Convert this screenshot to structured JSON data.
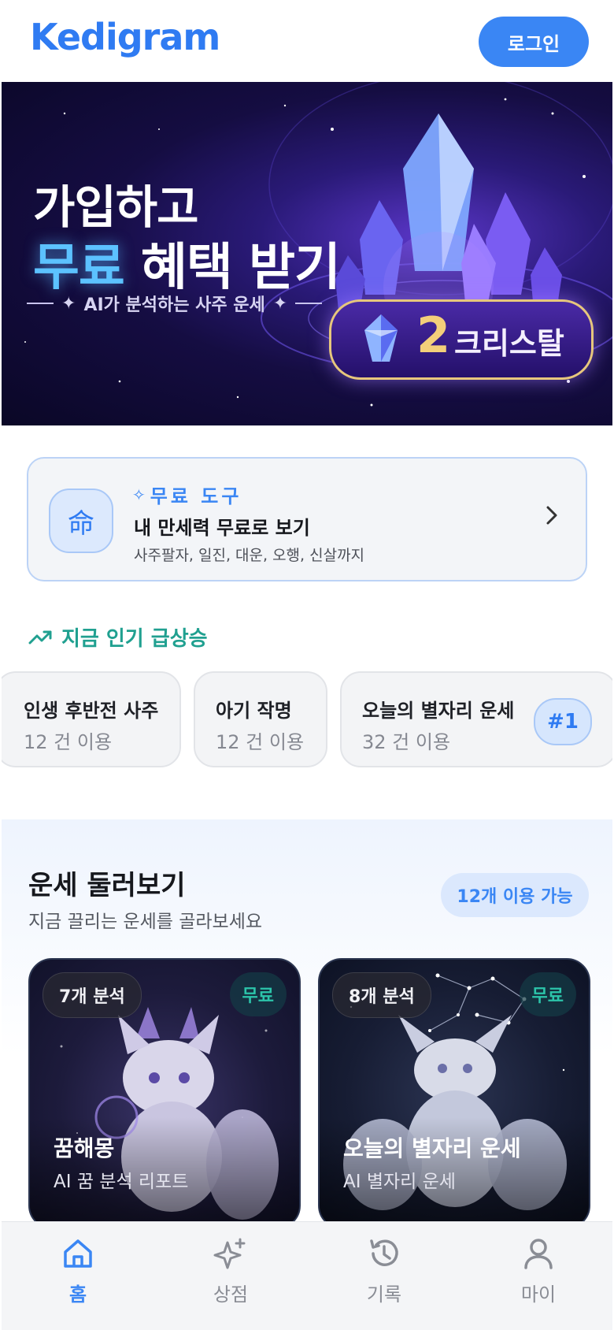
{
  "header": {
    "logo": "Kedigram",
    "login_label": "로그인"
  },
  "banner": {
    "title_line1": "가입하고",
    "title_highlight": "무료",
    "title_rest": "혜택 받기",
    "subtitle": "AI가 분석하는 사주 운세",
    "crystal_count": "2",
    "crystal_label": "크리스탈"
  },
  "free_tool": {
    "tag": "무료 도구",
    "icon_glyph": "命",
    "title": "내 만세력 무료로 보기",
    "description": "사주팔자, 일진, 대운, 오행, 신살까지"
  },
  "trending": {
    "title": "지금 인기 급상승",
    "items": [
      {
        "title": "인생 후반전 사주",
        "count": "12 건 이용"
      },
      {
        "title": "아기 작명",
        "count": "12 건 이용"
      },
      {
        "title": "오늘의 별자리 운세",
        "count": "32 건 이용",
        "rank": "#1"
      }
    ]
  },
  "browse": {
    "title": "운세 둘러보기",
    "subtitle": "지금 끌리는 운세를 골라보세요",
    "available": "12개 이용 가능",
    "cards": [
      {
        "count": "7개 분석",
        "badge": "무료",
        "title": "꿈해몽",
        "subtitle": "AI 꿈 분석 리포트"
      },
      {
        "count": "8개 분석",
        "badge": "무료",
        "title": "오늘의 별자리 운세",
        "subtitle": "AI 별자리 운세"
      }
    ]
  },
  "nav": {
    "items": [
      {
        "label": "홈",
        "icon": "home-icon",
        "active": true
      },
      {
        "label": "상점",
        "icon": "sparkle-icon",
        "active": false
      },
      {
        "label": "기록",
        "icon": "history-icon",
        "active": false
      },
      {
        "label": "마이",
        "icon": "user-icon",
        "active": false
      }
    ]
  },
  "colors": {
    "primary": "#3a86f4",
    "teal": "#20a090",
    "banner_bg": "#150d42",
    "gold": "#f3cf7a"
  }
}
